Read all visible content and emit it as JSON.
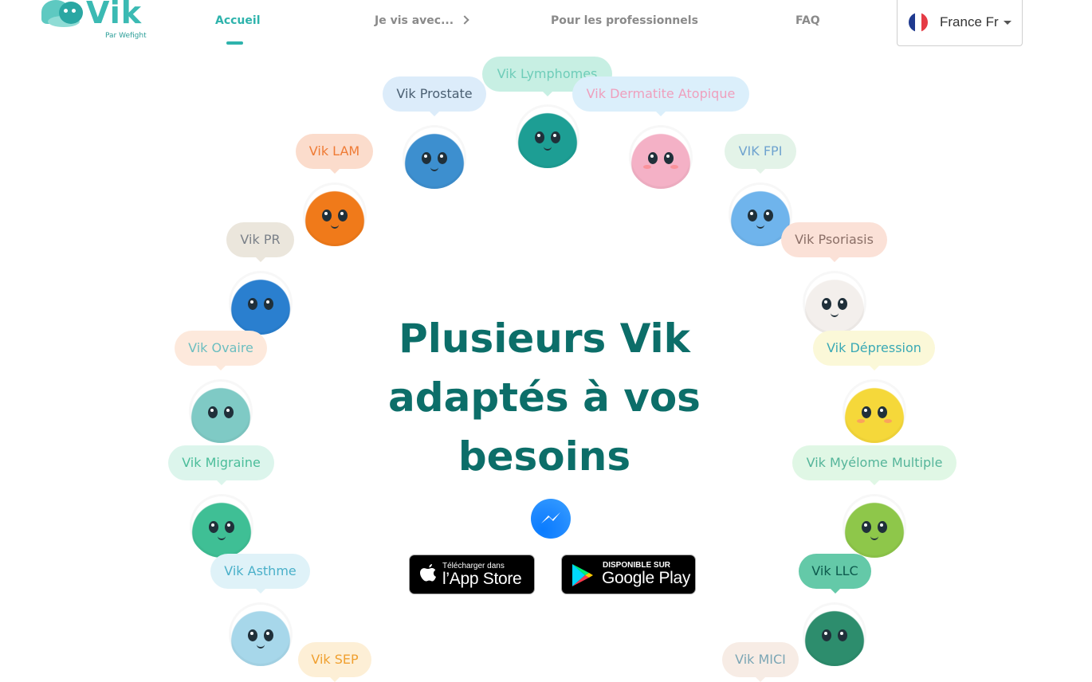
{
  "logo": {
    "name": "Vik",
    "subtitle": "Par Wefight"
  },
  "nav": {
    "items": [
      {
        "label": "Accueil"
      },
      {
        "label": "Je vis avec..."
      },
      {
        "label": "Pour les professionnels"
      },
      {
        "label": "FAQ"
      }
    ],
    "language": {
      "label": "France Fr",
      "flag": "france-flag-icon"
    }
  },
  "headline": [
    "Plusieurs Vik",
    "adaptés à vos",
    "besoins"
  ],
  "stores": {
    "apple": {
      "small": "Télécharger dans",
      "big": "l’App Store"
    },
    "google": {
      "small": "DISPONIBLE SUR",
      "big": "Google Play"
    }
  },
  "viks": [
    {
      "label": "Vik Lymphomes",
      "pill_bg": "#c7efe3",
      "text_color": "#6fcdb9",
      "body": "#1d9e94"
    },
    {
      "label": "Vik Prostate",
      "pill_bg": "#dcecfa",
      "text_color": "#4a5f72",
      "body": "#3d8fcf"
    },
    {
      "label": "Vik Dermatite Atopique",
      "pill_bg": "#dbeffb",
      "text_color": "#ef9fbd",
      "body": "#f4b1c6"
    },
    {
      "label": "Vik LAM",
      "pill_bg": "#fbdccc",
      "text_color": "#ef7b35",
      "body": "#f07a1a"
    },
    {
      "label": "VIK FPI",
      "pill_bg": "#e3f3e8",
      "text_color": "#6fa3cf",
      "body": "#6fb4ec"
    },
    {
      "label": "Vik PR",
      "pill_bg": "#ebe6dc",
      "text_color": "#7a8088",
      "body": "#2a7fcf"
    },
    {
      "label": "Vik Psoriasis",
      "pill_bg": "#fbe1d7",
      "text_color": "#8b6f67",
      "body": "#f3efec"
    },
    {
      "label": "Vik Ovaire",
      "pill_bg": "#fde9dc",
      "text_color": "#6cbec0",
      "body": "#7fcac5"
    },
    {
      "label": "Vik Dépression",
      "pill_bg": "#fbf8d8",
      "text_color": "#3aa9b5",
      "body": "#f5d83a"
    },
    {
      "label": "Vik Migraine",
      "pill_bg": "#dcf5ec",
      "text_color": "#4bbd9a",
      "body": "#3fbf95"
    },
    {
      "label": "Vik Myélome Multiple",
      "pill_bg": "#e0f7e5",
      "text_color": "#55b59a",
      "body": "#8ec74a"
    },
    {
      "label": "Vik Asthme",
      "pill_bg": "#dff2f8",
      "text_color": "#4ab0c9",
      "body": "#a7d7ea"
    },
    {
      "label": "Vik LLC",
      "pill_bg": "#64c9a8",
      "text_color": "#0d5a4d",
      "body": "#2d8d6d"
    },
    {
      "label": "Vik SEP",
      "pill_bg": "#fdefd6",
      "text_color": "#f0a030",
      "body": "#f5c45f"
    },
    {
      "label": "Vik MICI",
      "pill_bg": "#f7ece5",
      "text_color": "#7ba6b5",
      "body": "#a8c9d8"
    }
  ]
}
